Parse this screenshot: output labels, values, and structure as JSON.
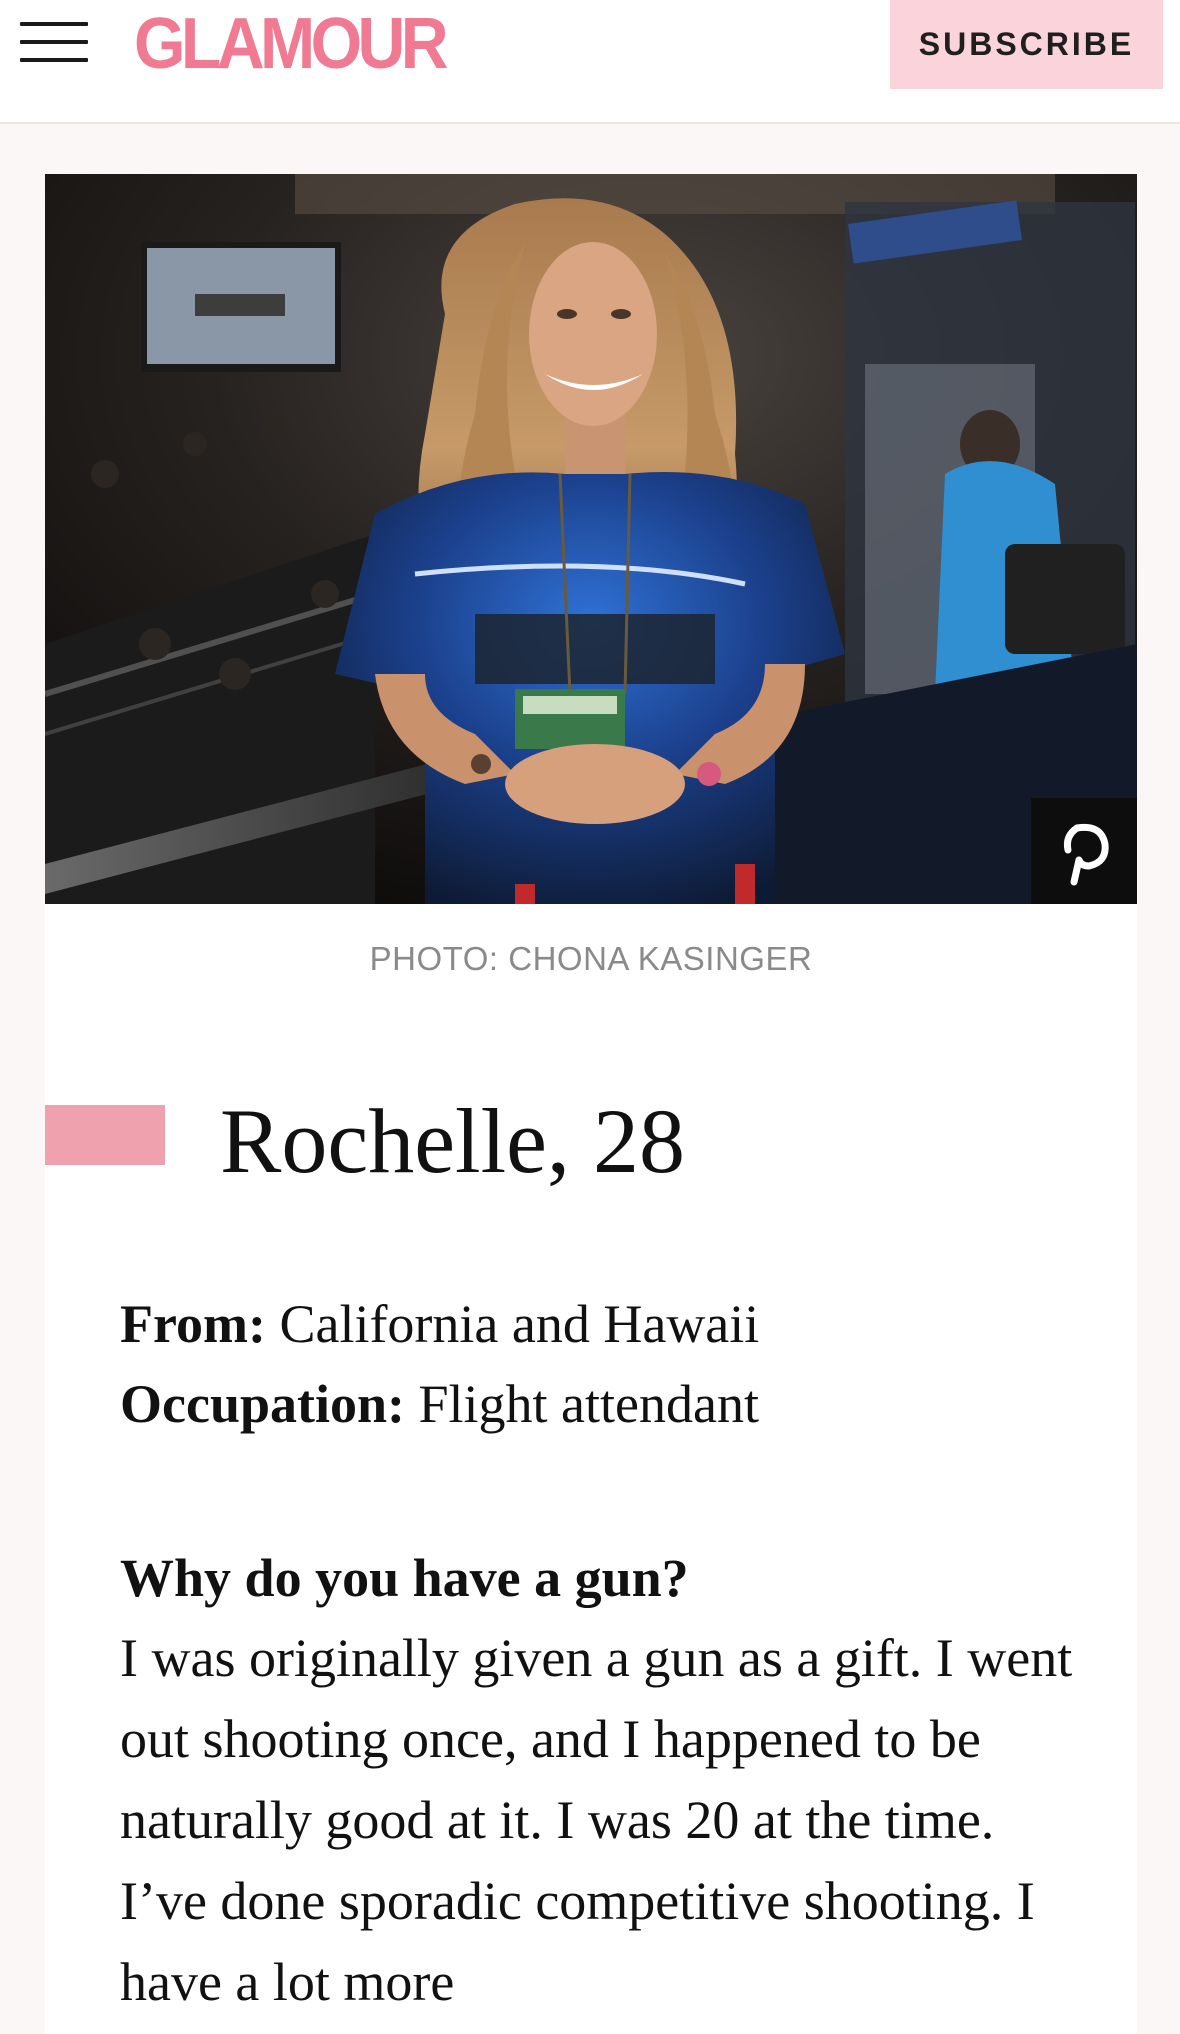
{
  "colors": {
    "brand_pink": "#ef7a92",
    "subscribe_bg": "#fbd3da",
    "marker_pink": "#efa2ad"
  },
  "header": {
    "menu_icon": "hamburger-menu-icon",
    "logo_text": "GLAMOUR",
    "subscribe_label": "SUBSCRIBE"
  },
  "hero": {
    "pin_icon": "pinterest-icon",
    "credit": "PHOTO: CHONA KASINGER"
  },
  "article": {
    "name_heading": "Rochelle, 28",
    "facts": [
      {
        "label": "From:",
        "value": "California and Hawaii"
      },
      {
        "label": "Occupation:",
        "value": "Flight attendant"
      }
    ],
    "question": "Why do you have a gun?",
    "answer": "I was originally given a gun as a gift. I went out shooting once, and I happened to be naturally good at it. I was 20 at the time. I’ve done sporadic competitive shooting. I have a lot more"
  }
}
